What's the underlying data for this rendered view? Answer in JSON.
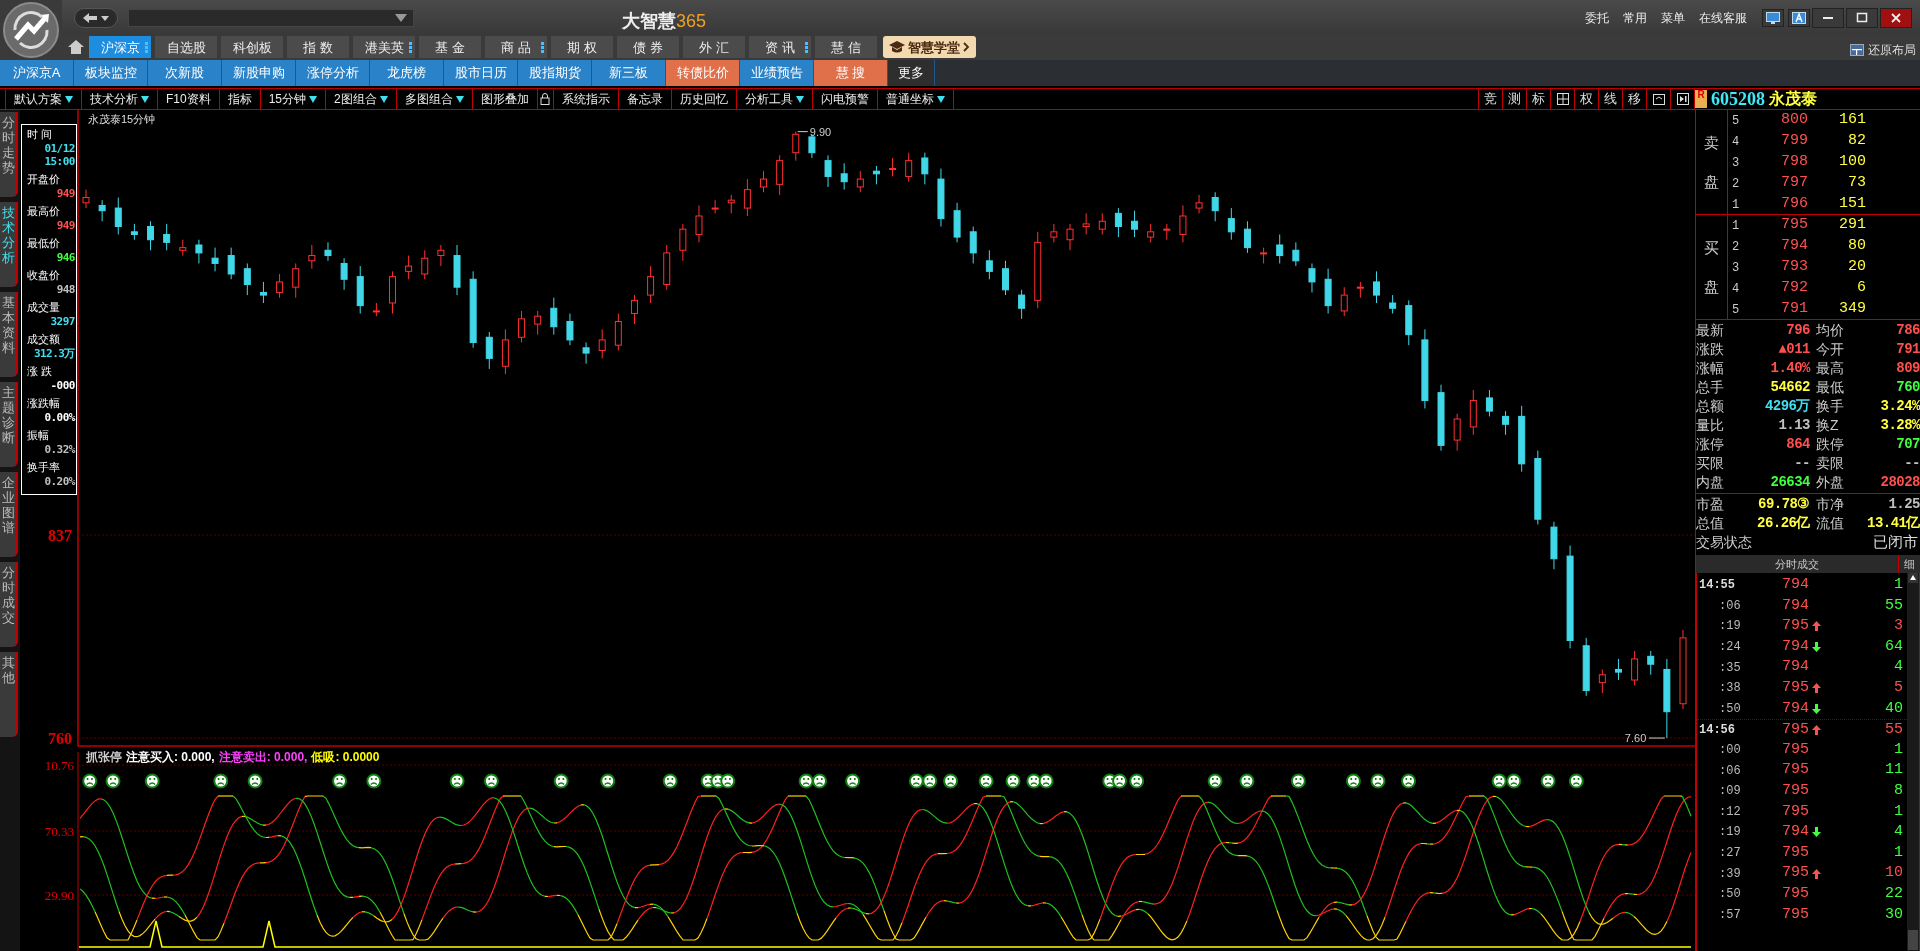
{
  "app": {
    "title": "大智慧",
    "title_suffix": "365",
    "links": [
      "委托",
      "常用",
      "菜单",
      "在线客服"
    ],
    "restore_layout": "还原布局"
  },
  "main_tabs": [
    {
      "label": "沪深京",
      "selected": true,
      "menu": true
    },
    {
      "label": "自选股",
      "selected": false,
      "menu": false
    },
    {
      "label": "科创板",
      "selected": false,
      "menu": false
    },
    {
      "label": "指 数",
      "selected": false,
      "menu": false
    },
    {
      "label": "港美英",
      "selected": false,
      "menu": true
    },
    {
      "label": "基 金",
      "selected": false,
      "menu": false
    },
    {
      "label": "商 品",
      "selected": false,
      "menu": true
    },
    {
      "label": "期 权",
      "selected": false,
      "menu": false
    },
    {
      "label": "债 券",
      "selected": false,
      "menu": false
    },
    {
      "label": "外 汇",
      "selected": false,
      "menu": false
    },
    {
      "label": "资 讯",
      "selected": false,
      "menu": true
    },
    {
      "label": "慧 信",
      "selected": false,
      "menu": false
    }
  ],
  "academy_button": "智慧学堂",
  "sub_tabs": [
    {
      "label": "沪深京A",
      "kind": "normal"
    },
    {
      "label": "板块监控",
      "kind": "normal"
    },
    {
      "label": "次新股",
      "kind": "normal"
    },
    {
      "label": "新股申购",
      "kind": "normal"
    },
    {
      "label": "涨停分析",
      "kind": "normal"
    },
    {
      "label": "龙虎榜",
      "kind": "normal"
    },
    {
      "label": "股市日历",
      "kind": "normal"
    },
    {
      "label": "股指期货",
      "kind": "normal"
    },
    {
      "label": "新三板",
      "kind": "normal"
    },
    {
      "label": "转债比价",
      "kind": "accent"
    },
    {
      "label": "业绩预告",
      "kind": "normal"
    },
    {
      "label": "慧 搜",
      "kind": "accent"
    },
    {
      "label": "更多",
      "kind": "more"
    }
  ],
  "toolbar": [
    {
      "label": "默认方案",
      "dropdown": true
    },
    {
      "label": "技术分析",
      "dropdown": true
    },
    {
      "label": "F10资料",
      "dropdown": false
    },
    {
      "label": "指标",
      "dropdown": false
    },
    {
      "label": "15分钟",
      "dropdown": true
    },
    {
      "label": "2图组合",
      "dropdown": true
    },
    {
      "label": "多图组合",
      "dropdown": true
    },
    {
      "label": "图形叠加",
      "dropdown": false,
      "lock": true
    },
    {
      "label": "系统指示",
      "dropdown": false
    },
    {
      "label": "备忘录",
      "dropdown": false
    },
    {
      "label": "历史回忆",
      "dropdown": false
    },
    {
      "label": "分析工具",
      "dropdown": true
    },
    {
      "label": "闪电预警",
      "dropdown": false
    },
    {
      "label": "普通坐标",
      "dropdown": true
    }
  ],
  "chart_tools": [
    {
      "kind": "text",
      "label": "竞"
    },
    {
      "kind": "text",
      "label": "测"
    },
    {
      "kind": "text",
      "label": "标"
    },
    {
      "kind": "grid"
    },
    {
      "kind": "text",
      "label": "权"
    },
    {
      "kind": "text",
      "label": "线"
    },
    {
      "kind": "text",
      "label": "移"
    },
    {
      "kind": "window"
    },
    {
      "kind": "play"
    }
  ],
  "stock": {
    "badge": "R",
    "code": "605208",
    "name": "永茂泰"
  },
  "side_tabs": [
    {
      "label": "分时走势",
      "selected": false
    },
    {
      "label": "技术分析",
      "selected": true
    },
    {
      "label": "基本资料",
      "selected": false
    },
    {
      "label": "主题诊断",
      "selected": false
    },
    {
      "label": "企业图谱",
      "selected": false
    },
    {
      "label": "分时成交",
      "selected": false
    },
    {
      "label": "其他",
      "selected": false
    }
  ],
  "info_box": [
    {
      "label": "时 间",
      "values": [
        "01/12",
        "15:00"
      ],
      "color": "#40e0f0"
    },
    {
      "label": "开盘价",
      "values": [
        "949"
      ],
      "color": "#ff5050"
    },
    {
      "label": "最高价",
      "values": [
        "949"
      ],
      "color": "#ff5050"
    },
    {
      "label": "最低价",
      "values": [
        "946"
      ],
      "color": "#40ff40"
    },
    {
      "label": "收盘价",
      "values": [
        "948"
      ],
      "color": "#c0c0c0"
    },
    {
      "label": "成交量",
      "values": [
        "3297"
      ],
      "color": "#40e0f0"
    },
    {
      "label": "成交额",
      "values": [
        "312.3万"
      ],
      "color": "#40e0f0"
    },
    {
      "label": "涨 跌",
      "values": [
        "-000"
      ],
      "color": "#ffffff"
    },
    {
      "label": "涨跌幅",
      "values": [
        "0.00%"
      ],
      "color": "#ffffff"
    },
    {
      "label": "振幅",
      "values": [
        "0.32%"
      ],
      "color": "#c0c0c0"
    },
    {
      "label": "换手率",
      "values": [
        "0.20%"
      ],
      "color": "#c0c0c0"
    }
  ],
  "chart": {
    "title": "永茂泰15分钟",
    "high_mark": "9.90",
    "low_mark": "7.60",
    "chart_data": {
      "type": "candlestick",
      "ylim": [
        756.6,
        998.2
      ],
      "yticks": [
        {
          "value": 837,
          "label": "837"
        },
        {
          "value": 760,
          "label": "760"
        }
      ],
      "ohlc": [
        [
          963,
          968,
          961,
          965
        ],
        [
          962,
          964,
          956,
          960
        ],
        [
          961,
          965,
          951,
          954
        ],
        [
          952,
          955,
          949,
          951
        ],
        [
          954,
          956,
          945,
          949
        ],
        [
          951,
          955,
          945,
          948
        ],
        [
          945,
          949,
          943,
          946
        ],
        [
          947,
          949,
          940,
          944
        ],
        [
          942,
          946,
          937,
          940
        ],
        [
          943,
          946,
          934,
          936
        ],
        [
          938,
          940,
          928,
          932
        ],
        [
          929,
          933,
          925,
          928
        ],
        [
          929,
          936,
          927,
          933
        ],
        [
          931,
          940,
          927,
          938
        ],
        [
          941,
          947,
          938,
          943
        ],
        [
          945,
          948,
          941,
          943
        ],
        [
          940,
          942,
          930,
          934
        ],
        [
          935,
          939,
          921,
          924
        ],
        [
          922,
          925,
          920,
          922
        ],
        [
          925,
          937,
          921,
          935
        ],
        [
          937,
          943,
          934,
          939
        ],
        [
          936,
          945,
          934,
          942
        ],
        [
          943,
          947,
          939,
          945
        ],
        [
          943,
          947,
          928,
          931
        ],
        [
          934,
          937,
          908,
          910
        ],
        [
          912,
          914,
          900,
          904
        ],
        [
          901,
          915,
          898,
          911
        ],
        [
          912,
          922,
          910,
          919
        ],
        [
          917,
          922,
          913,
          920
        ],
        [
          923,
          927,
          913,
          916
        ],
        [
          918,
          921,
          909,
          911
        ],
        [
          908,
          910,
          902,
          906
        ],
        [
          907,
          915,
          904,
          911
        ],
        [
          909,
          921,
          907,
          918
        ],
        [
          921,
          928,
          917,
          926
        ],
        [
          928,
          939,
          925,
          935
        ],
        [
          932,
          947,
          930,
          944
        ],
        [
          945,
          955,
          941,
          953
        ],
        [
          951,
          962,
          948,
          958
        ],
        [
          961,
          964,
          959,
          961
        ],
        [
          963,
          966,
          959,
          964
        ],
        [
          961,
          972,
          958,
          968
        ],
        [
          969,
          975,
          967,
          972
        ],
        [
          970,
          981,
          966,
          979
        ],
        [
          982,
          990,
          979,
          989
        ],
        [
          988,
          989,
          980,
          982
        ],
        [
          979,
          981,
          969,
          973
        ],
        [
          974,
          978,
          968,
          971
        ],
        [
          969,
          975,
          967,
          972
        ],
        [
          975,
          977,
          970,
          974
        ],
        [
          976,
          980,
          973,
          976
        ],
        [
          973,
          982,
          971,
          979
        ],
        [
          980,
          982,
          970,
          974
        ],
        [
          972,
          976,
          954,
          957
        ],
        [
          960,
          963,
          948,
          950
        ],
        [
          952,
          954,
          940,
          944
        ],
        [
          941,
          945,
          934,
          937
        ],
        [
          938,
          941,
          928,
          930
        ],
        [
          928,
          930,
          919,
          923
        ],
        [
          926,
          952,
          923,
          948
        ],
        [
          950,
          955,
          948,
          952
        ],
        [
          949,
          955,
          945,
          953
        ],
        [
          954,
          959,
          951,
          955
        ],
        [
          953,
          959,
          951,
          956
        ],
        [
          959,
          961,
          950,
          954
        ],
        [
          956,
          960,
          950,
          953
        ],
        [
          950,
          955,
          948,
          952
        ],
        [
          953,
          955,
          949,
          953
        ],
        [
          951,
          962,
          948,
          958
        ],
        [
          961,
          966,
          959,
          963
        ],
        [
          965,
          967,
          956,
          960
        ],
        [
          957,
          961,
          949,
          952
        ],
        [
          953,
          956,
          944,
          946
        ],
        [
          944,
          946,
          940,
          944
        ],
        [
          947,
          951,
          940,
          943
        ],
        [
          945,
          948,
          939,
          941
        ],
        [
          938,
          940,
          929,
          933
        ],
        [
          934,
          938,
          921,
          924
        ],
        [
          922,
          931,
          920,
          928
        ],
        [
          931,
          933,
          927,
          931
        ],
        [
          933,
          937,
          925,
          928
        ],
        [
          925,
          928,
          921,
          923
        ],
        [
          924,
          926,
          909,
          913
        ],
        [
          911,
          915,
          885,
          888
        ],
        [
          891,
          894,
          869,
          871
        ],
        [
          873,
          883,
          869,
          881
        ],
        [
          878,
          892,
          875,
          888
        ],
        [
          889,
          892,
          882,
          884
        ],
        [
          882,
          884,
          875,
          879
        ],
        [
          882,
          886,
          861,
          864
        ],
        [
          866,
          869,
          841,
          843
        ],
        [
          840,
          842,
          824,
          828
        ],
        [
          829,
          833,
          794,
          797
        ],
        [
          795,
          798,
          776,
          778
        ],
        [
          781,
          786,
          777,
          784
        ],
        [
          786,
          790,
          782,
          785
        ],
        [
          782,
          793,
          780,
          790
        ],
        [
          791,
          793,
          784,
          788
        ],
        [
          786,
          790,
          760,
          770
        ],
        [
          773,
          801,
          771,
          798
        ]
      ]
    }
  },
  "indicator": {
    "name": "抓张停",
    "legends": [
      {
        "text": "注意买入: 0.000,",
        "color": "#ffffff"
      },
      {
        "text": "注意卖出: 0.000,",
        "color": "#ff40ff"
      },
      {
        "text": "低吸: 0.0000",
        "color": "#ffff00"
      }
    ],
    "axis_labels": [
      "10.76",
      "70.33",
      "29.90"
    ]
  },
  "order_book": {
    "sell_label": "卖盘",
    "buy_label": "买盘",
    "sell": [
      {
        "level": "5",
        "price": "800",
        "volume": "161"
      },
      {
        "level": "4",
        "price": "799",
        "volume": "82"
      },
      {
        "level": "3",
        "price": "798",
        "volume": "100"
      },
      {
        "level": "2",
        "price": "797",
        "volume": "73"
      },
      {
        "level": "1",
        "price": "796",
        "volume": "151"
      }
    ],
    "buy": [
      {
        "level": "1",
        "price": "795",
        "volume": "291"
      },
      {
        "level": "2",
        "price": "794",
        "volume": "80"
      },
      {
        "level": "3",
        "price": "793",
        "volume": "20"
      },
      {
        "level": "4",
        "price": "792",
        "volume": "6"
      },
      {
        "level": "5",
        "price": "791",
        "volume": "349"
      }
    ]
  },
  "quote": [
    {
      "left": {
        "label": "最新",
        "value": "796",
        "color": "#ff5050"
      },
      "right": {
        "label": "均价",
        "value": "786",
        "color": "#ff5050"
      }
    },
    {
      "left": {
        "label": "涨跌",
        "value": "▲011",
        "color": "#ff5050"
      },
      "right": {
        "label": "今开",
        "value": "791",
        "color": "#ff5050"
      }
    },
    {
      "left": {
        "label": "涨幅",
        "value": "1.40%",
        "color": "#ff5050"
      },
      "right": {
        "label": "最高",
        "value": "809",
        "color": "#ff5050"
      }
    },
    {
      "left": {
        "label": "总手",
        "value": "54662",
        "color": "#ffff40"
      },
      "right": {
        "label": "最低",
        "value": "760",
        "color": "#40ff40"
      }
    },
    {
      "left": {
        "label": "总额",
        "value": "4296万",
        "color": "#40e0f0"
      },
      "right": {
        "label": "换手",
        "value": "3.24%",
        "color": "#ffff40"
      }
    },
    {
      "left": {
        "label": "量比",
        "value": "1.13",
        "color": "#c0c0c0"
      },
      "right": {
        "label": "换Z",
        "value": "3.28%",
        "color": "#ffff40"
      }
    },
    {
      "left": {
        "label": "涨停",
        "value": "864",
        "color": "#ff5050"
      },
      "right": {
        "label": "跌停",
        "value": "707",
        "color": "#40ff40"
      }
    },
    {
      "left": {
        "label": "买限",
        "value": "--",
        "color": "#c0c0c0"
      },
      "right": {
        "label": "卖限",
        "value": "--",
        "color": "#c0c0c0"
      }
    },
    {
      "left": {
        "label": "内盘",
        "value": "26634",
        "color": "#40ff40"
      },
      "right": {
        "label": "外盘",
        "value": "28028",
        "color": "#ff5050"
      }
    }
  ],
  "valuation": [
    {
      "left": {
        "label": "市盈",
        "value": "69.78③",
        "color": "#ffff40"
      },
      "right": {
        "label": "市净",
        "value": "1.25",
        "color": "#c0c0c0"
      }
    },
    {
      "left": {
        "label": "总值",
        "value": "26.26亿",
        "color": "#ffff40"
      },
      "right": {
        "label": "流值",
        "value": "13.41亿",
        "color": "#ffff40"
      }
    }
  ],
  "trade_status": {
    "label": "交易状态",
    "value": "已闭市"
  },
  "ticks_header": {
    "title": "分时成交",
    "detail": "细"
  },
  "ticks": [
    {
      "time": "14:55",
      "price": "794",
      "kind": "flat",
      "volume": "1",
      "minute": true
    },
    {
      "time": ":06",
      "price": "794",
      "kind": "flat",
      "volume": "55",
      "minute": false
    },
    {
      "time": ":19",
      "price": "795",
      "kind": "up",
      "volume": "3",
      "minute": false
    },
    {
      "time": ":24",
      "price": "794",
      "kind": "down",
      "volume": "64",
      "minute": false
    },
    {
      "time": ":35",
      "price": "794",
      "kind": "flat",
      "volume": "4",
      "minute": false
    },
    {
      "time": ":38",
      "price": "795",
      "kind": "up",
      "volume": "5",
      "minute": false
    },
    {
      "time": ":50",
      "price": "794",
      "kind": "down",
      "volume": "40",
      "minute": false
    },
    {
      "time": "14:56",
      "price": "795",
      "kind": "up",
      "volume": "55",
      "minute": true
    },
    {
      "time": ":00",
      "price": "795",
      "kind": "flat",
      "volume": "1",
      "minute": false
    },
    {
      "time": ":06",
      "price": "795",
      "kind": "flat",
      "volume": "11",
      "minute": false
    },
    {
      "time": ":09",
      "price": "795",
      "kind": "flat",
      "volume": "8",
      "minute": false
    },
    {
      "time": ":12",
      "price": "795",
      "kind": "flat",
      "volume": "1",
      "minute": false
    },
    {
      "time": ":19",
      "price": "794",
      "kind": "down",
      "volume": "4",
      "minute": false
    },
    {
      "time": ":27",
      "price": "795",
      "kind": "flat",
      "volume": "1",
      "minute": false
    },
    {
      "time": ":39",
      "price": "795",
      "kind": "up",
      "volume": "10",
      "minute": false
    },
    {
      "time": ":50",
      "price": "795",
      "kind": "flat",
      "volume": "22",
      "minute": false
    },
    {
      "time": ":57",
      "price": "795",
      "kind": "flat",
      "volume": "30",
      "minute": false
    }
  ]
}
